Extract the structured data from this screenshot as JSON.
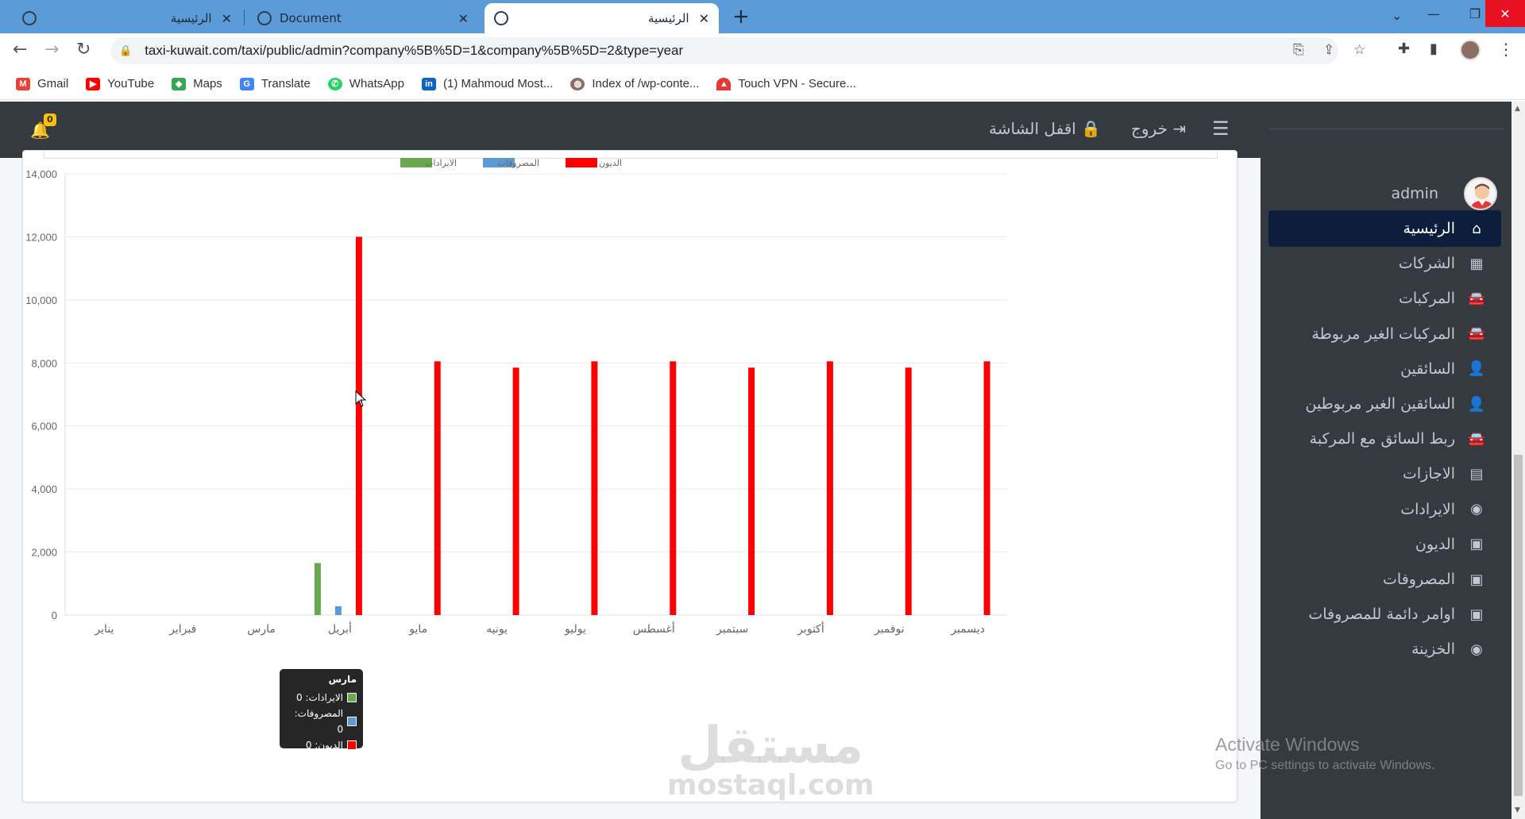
{
  "browser": {
    "tabs": [
      {
        "title": "الرئيسية",
        "active": false
      },
      {
        "title": "Document",
        "active": false
      },
      {
        "title": "الرئيسية",
        "active": true
      }
    ],
    "close_glyph": "✕",
    "new_tab_glyph": "+",
    "url": "taxi-kuwait.com/taxi/public/admin?company%5B%5D=1&company%5B%5D=2&type=year",
    "bookmarks": [
      {
        "label": "Gmail",
        "icon": "gmail-icon",
        "color": "#ea4335"
      },
      {
        "label": "YouTube",
        "icon": "youtube-icon",
        "color": "#ff0000"
      },
      {
        "label": "Maps",
        "icon": "maps-icon",
        "color": "#34a853"
      },
      {
        "label": "Translate",
        "icon": "translate-icon",
        "color": "#4285f4"
      },
      {
        "label": "WhatsApp",
        "icon": "whatsapp-icon",
        "color": "#25d366"
      },
      {
        "label": "(1) Mahmoud Most...",
        "icon": "linkedin-icon",
        "color": "#0a66c2"
      },
      {
        "label": "Index of /wp-conte...",
        "icon": "site-icon",
        "color": "#8d6e63"
      },
      {
        "label": "Touch VPN - Secure...",
        "icon": "vpn-icon",
        "color": "#e53935"
      }
    ]
  },
  "topnav": {
    "notification_count": "0",
    "lock_screen_label": "اقفل الشاشة",
    "logout_label": "خروج"
  },
  "sidebar": {
    "user_name": "admin",
    "items": [
      {
        "label": "الرئيسية",
        "icon": "home-icon",
        "glyph": "⌂",
        "active": true
      },
      {
        "label": "الشركات",
        "icon": "grid-icon",
        "glyph": "▦",
        "active": false
      },
      {
        "label": "المركبات",
        "icon": "car-icon",
        "glyph": "🚘",
        "active": false
      },
      {
        "label": "المركبات الغير مربوطة",
        "icon": "car-icon",
        "glyph": "🚘",
        "active": false
      },
      {
        "label": "السائقين",
        "icon": "user-icon",
        "glyph": "👤",
        "active": false
      },
      {
        "label": "السائقين الغير مربوطين",
        "icon": "user-icon",
        "glyph": "👤",
        "active": false
      },
      {
        "label": "ربط السائق مع المركبة",
        "icon": "car-icon",
        "glyph": "🚘",
        "active": false
      },
      {
        "label": "الاجازات",
        "icon": "calendar-icon",
        "glyph": "▤",
        "active": false
      },
      {
        "label": "الايرادات",
        "icon": "coins-icon",
        "glyph": "◉",
        "active": false
      },
      {
        "label": "الديون",
        "icon": "money-bill-icon",
        "glyph": "▣",
        "active": false
      },
      {
        "label": "المصروفات",
        "icon": "money-bill-icon",
        "glyph": "▣",
        "active": false
      },
      {
        "label": "اوامر دائمة للمصروفات",
        "icon": "money-bill-icon",
        "glyph": "▣",
        "active": false
      },
      {
        "label": "الخزينة",
        "icon": "coins-icon",
        "glyph": "◉",
        "active": false
      }
    ]
  },
  "chart_data": {
    "type": "bar",
    "categories": [
      "يناير",
      "فبراير",
      "مارس",
      "أبريل",
      "مايو",
      "يونيه",
      "يوليو",
      "أغسطس",
      "سبتمبر",
      "أكتوبر",
      "نوفمبر",
      "ديسمبر"
    ],
    "series": [
      {
        "name": "الايرادات",
        "color": "#6aa84f",
        "values": [
          0,
          0,
          0,
          1650,
          0,
          0,
          0,
          0,
          0,
          0,
          0,
          0
        ]
      },
      {
        "name": "المصروفات",
        "color": "#5b9bd5",
        "values": [
          0,
          0,
          0,
          280,
          0,
          0,
          0,
          0,
          0,
          0,
          0,
          0
        ]
      },
      {
        "name": "الديون",
        "color": "#ff0000",
        "values": [
          0,
          0,
          0,
          12000,
          8050,
          7850,
          8050,
          8050,
          7850,
          8050,
          7850,
          8050
        ]
      }
    ],
    "ylim": [
      0,
      14000
    ],
    "yticks": [
      "0",
      "2,000",
      "4,000",
      "6,000",
      "8,000",
      "10,000",
      "12,000",
      "14,000"
    ],
    "grid": true,
    "legend_position": "top-center",
    "tooltip": {
      "title": "مارس",
      "rows": [
        {
          "label": "الايرادات: 0",
          "color": "#6aa84f"
        },
        {
          "label": "المصروفات: 0",
          "color": "#5b9bd5"
        },
        {
          "label": "الديون: 0",
          "color": "#ff0000"
        }
      ]
    }
  },
  "overlay": {
    "activate_title": "Activate Windows",
    "activate_sub": "Go to PC settings to activate Windows.",
    "watermark_ar": "مستقل",
    "watermark_en": "mostaql.com"
  }
}
